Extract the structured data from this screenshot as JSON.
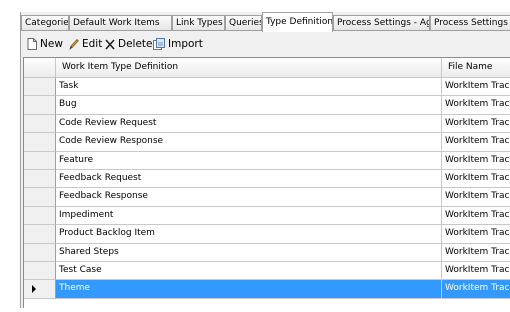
{
  "tabs": [
    {
      "label": "Categories",
      "active": false
    },
    {
      "label": "Default Work Items",
      "active": false
    },
    {
      "label": "Link Types",
      "active": false
    },
    {
      "label": "Queries",
      "active": false
    },
    {
      "label": "Type Definitions",
      "active": true
    },
    {
      "label": "Process Settings - Agile",
      "active": false
    },
    {
      "label": "Process Settings - Common",
      "active": false
    }
  ],
  "toolbar": {
    "new_label": "New",
    "edit_label": "Edit",
    "delete_label": "Delete",
    "import_label": "Import"
  },
  "grid": {
    "columns": [
      "Work Item Type Definition",
      "File Name"
    ],
    "rows": [
      {
        "name": "Task",
        "file": "WorkItem Tracking\\TypeDefinitions\\Task.xml"
      },
      {
        "name": "Bug",
        "file": "WorkItem Tracking\\TypeDefinitions\\Bug.xml"
      },
      {
        "name": "Code Review Request",
        "file": "WorkItem Tracking\\TypeDefinitions\\CodeReviewRequest.xml"
      },
      {
        "name": "Code Review Response",
        "file": "WorkItem Tracking\\TypeDefinitions\\CodeReviewResponse.xml"
      },
      {
        "name": "Feature",
        "file": "WorkItem Tracking\\TypeDefinitions\\Feature.xml"
      },
      {
        "name": "Feedback Request",
        "file": "WorkItem Tracking\\TypeDefinitions\\FeedbackRequest.xml"
      },
      {
        "name": "Feedback Response",
        "file": "WorkItem Tracking\\TypeDefinitions\\FeedbackResponse.xml"
      },
      {
        "name": "Impediment",
        "file": "WorkItem Tracking\\TypeDefinitions\\Impediment.xml"
      },
      {
        "name": "Product Backlog Item",
        "file": "WorkItem Tracking\\TypeDefinitions\\ProductBacklogItem.xml"
      },
      {
        "name": "Shared Steps",
        "file": "WorkItem Tracking\\TypeDefinitions\\SharedStep.xml"
      },
      {
        "name": "Test Case",
        "file": "WorkItem Tracking\\TypeDefinitions\\TestCase.xml"
      },
      {
        "name": "Theme",
        "file": "WorkItem Tracking\\TypeDefinitions\\Theme.xml",
        "selected": true
      }
    ]
  }
}
